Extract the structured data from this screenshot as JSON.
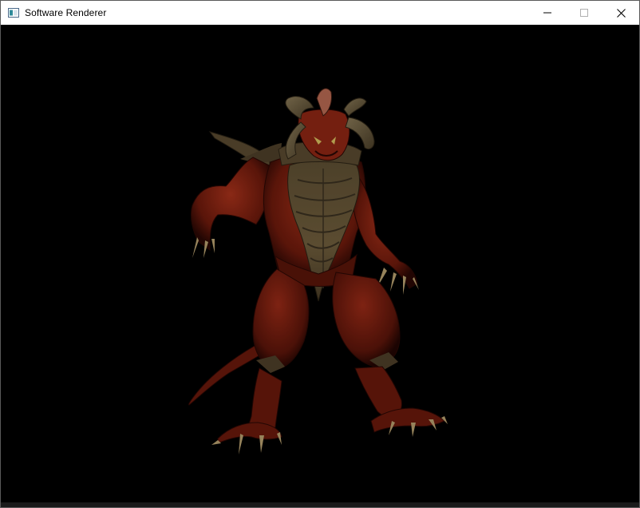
{
  "window": {
    "title": "Software Renderer"
  },
  "icons": {
    "app": "app-window-icon",
    "minimize": "minimize-icon",
    "maximize": "maximize-icon",
    "close": "close-icon"
  },
  "colors": {
    "titlebar_bg": "#ffffff",
    "viewport_bg": "#000000",
    "skin": "#7a1f10",
    "skin_dark": "#3f0d06",
    "skin_light": "#a8321b",
    "armor": "#6b5a3a",
    "armor_dark": "#3a3020",
    "horn": "#7a6a48",
    "claw": "#b8a070"
  }
}
